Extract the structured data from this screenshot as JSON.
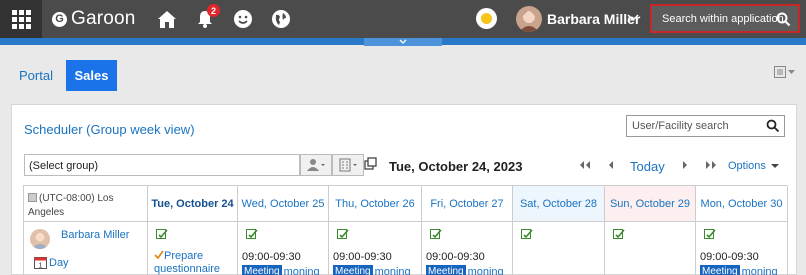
{
  "header": {
    "logo_letter": "G",
    "app_name": "Garoon",
    "notification_count": "2",
    "user_name": "Barbara Miller",
    "search_placeholder": "Search within application"
  },
  "portal_tabs": [
    {
      "label": "Portal",
      "active": false
    },
    {
      "label": "Sales",
      "active": true
    }
  ],
  "scheduler": {
    "title": "Scheduler (Group week view)",
    "facility_search_placeholder": "User/Facility search",
    "group_select": "(Select group)",
    "current_date": "Tue, October 24, 2023",
    "today_label": "Today",
    "options_label": "Options",
    "timezone": "(UTC-08:00) Los Angeles",
    "days": [
      {
        "label": "Tue, October 24",
        "kind": "today"
      },
      {
        "label": "Wed, October 25",
        "kind": "weekday"
      },
      {
        "label": "Thu, October 26",
        "kind": "weekday"
      },
      {
        "label": "Fri, October 27",
        "kind": "weekday"
      },
      {
        "label": "Sat, October 28",
        "kind": "saturday"
      },
      {
        "label": "Sun, October 29",
        "kind": "sunday"
      },
      {
        "label": "Mon, October 30",
        "kind": "weekday"
      }
    ],
    "user_row": {
      "name": "Barbara Miller",
      "day_link": "Day",
      "todo_label": "Prepare questionnaire",
      "event_time": "09:00-09:30",
      "event_tag": "Meeting",
      "event_title": "moning"
    }
  }
}
